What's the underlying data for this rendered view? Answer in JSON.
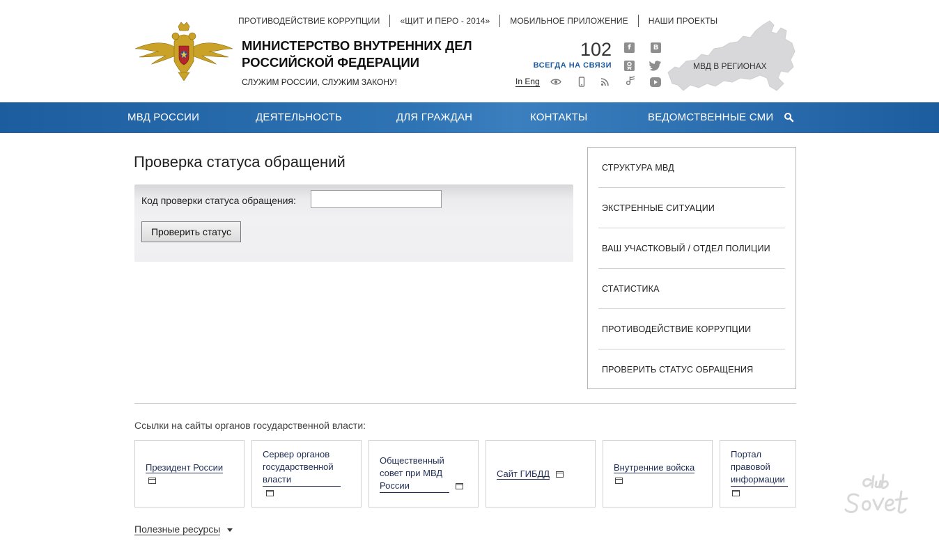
{
  "header": {
    "top_links": [
      "ПРОТИВОДЕЙСТВИЕ КОРРУПЦИИ",
      "«ЩИТ И ПЕРО - 2014»",
      "МОБИЛЬНОЕ ПРИЛОЖЕНИЕ",
      "НАШИ ПРОЕКТЫ"
    ],
    "title_line1": "МИНИСТЕРСТВО ВНУТРЕННИХ ДЕЛ",
    "title_line2": "РОССИЙСКОЙ ФЕДЕРАЦИИ",
    "slogan": "СЛУЖИМ РОССИИ, СЛУЖИМ ЗАКОНУ!",
    "hotline_number": "102",
    "hotline_caption": "ВСЕГДА НА СВЯЗИ",
    "lang_link": "In Eng",
    "map_label": "МВД В РЕГИОНАХ",
    "social_icons": [
      "facebook-icon",
      "vkontakte-icon",
      "odnoklassniki-icon",
      "twitter-icon",
      "youtube-icon"
    ],
    "tool_icons": [
      "eye-icon",
      "mobile-icon",
      "rss-icon",
      "podcast-icon"
    ]
  },
  "nav": {
    "items": [
      "МВД РОССИИ",
      "ДЕЯТЕЛЬНОСТЬ",
      "ДЛЯ ГРАЖДАН",
      "КОНТАКТЫ",
      "ВЕДОМСТВЕННЫЕ СМИ"
    ],
    "search_icon": "search-icon"
  },
  "main": {
    "page_title": "Проверка статуса обращений",
    "form": {
      "code_label": "Код проверки статуса обращения:",
      "code_value": "",
      "submit_label": "Проверить статус"
    }
  },
  "sidebar": {
    "items": [
      "СТРУКТУРА МВД",
      "ЭКСТРЕННЫЕ СИТУАЦИИ",
      "ВАШ УЧАСТКОВЫЙ / ОТДЕЛ ПОЛИЦИИ",
      "СТАТИСТИКА",
      "ПРОТИВОДЕЙСТВИЕ КОРРУПЦИИ",
      "ПРОВЕРИТЬ СТАТУС ОБРАЩЕНИЯ"
    ]
  },
  "gov_links": {
    "heading": "Ссылки на сайты органов государственной власти:",
    "items": [
      {
        "label": "Президент России"
      },
      {
        "label": "Сервер органов государственной власти"
      },
      {
        "label": "Общественный совет при МВД России"
      },
      {
        "label": "Сайт ГИБДД"
      },
      {
        "label": "Внутренние войска"
      },
      {
        "label": "Портал правовой информации"
      }
    ]
  },
  "resources": {
    "label": "Полезные ресурсы"
  },
  "watermark": {
    "text": "club Sovet"
  },
  "colors": {
    "nav_blue": "#1c5d9f",
    "hotline_blue": "#1d5a9e",
    "link_color": "#1f2d55"
  }
}
